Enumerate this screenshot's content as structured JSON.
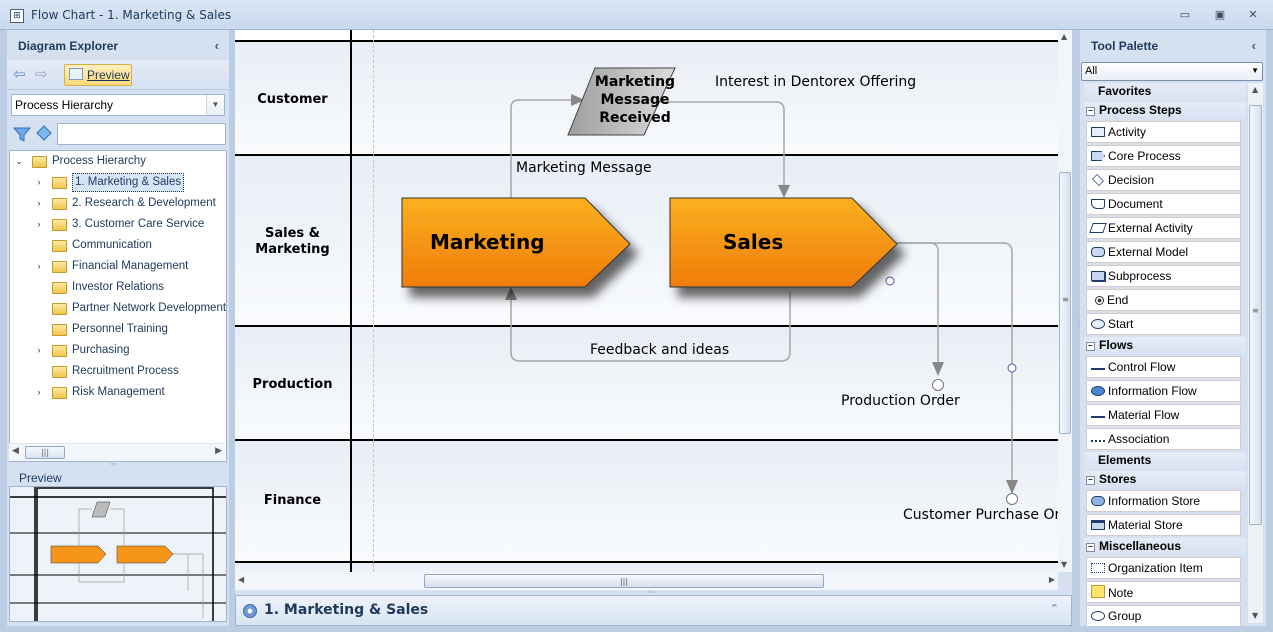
{
  "window": {
    "title": "Flow Chart - 1. Marketing & Sales",
    "app_icon": "org-chart-icon",
    "controls": {
      "minimize": "▭",
      "restore": "▣",
      "close": "✕"
    }
  },
  "diagram_explorer": {
    "title": "Diagram Explorer",
    "collapse_glyph": "‹",
    "back_glyph": "⇦",
    "forward_glyph": "⇨",
    "preview_button": "Preview",
    "view_select": "Process Hierarchy",
    "filter_placeholder": "",
    "tree": {
      "root": "Process Hierarchy",
      "items": [
        {
          "label": "1. Marketing & Sales",
          "expandable": true,
          "selected": true
        },
        {
          "label": "2. Research & Development",
          "expandable": true
        },
        {
          "label": "3. Customer Care Service",
          "expandable": true
        },
        {
          "label": "Communication",
          "expandable": false
        },
        {
          "label": "Financial Management",
          "expandable": true
        },
        {
          "label": "Investor Relations",
          "expandable": false
        },
        {
          "label": "Partner Network Development",
          "expandable": false
        },
        {
          "label": "Personnel Training",
          "expandable": false
        },
        {
          "label": "Purchasing",
          "expandable": true
        },
        {
          "label": "Recruitment Process",
          "expandable": false
        },
        {
          "label": "Risk Management",
          "expandable": true
        }
      ]
    },
    "preview_title": "Preview"
  },
  "diagram": {
    "lanes": [
      "Customer",
      "Sales & Marketing",
      "Production",
      "Finance"
    ],
    "shapes": {
      "message_received": "Marketing Message Received",
      "marketing": "Marketing",
      "sales": "Sales"
    },
    "labels": {
      "interest": "Interest in Dentorex Offering",
      "marketing_message": "Marketing Message",
      "feedback": "Feedback and ideas",
      "production_order": "Production Order",
      "customer_purchase_order": "Customer Purchase Ord"
    },
    "colors": {
      "process_top": "#fbb020",
      "process_bottom": "#f07c0a",
      "document_fill": "#b8b8b8",
      "connector": "#999999"
    }
  },
  "bottom_tab": {
    "title": "1. Marketing & Sales",
    "chevron": "⌃"
  },
  "tool_palette": {
    "title": "Tool Palette",
    "collapse_glyph": "‹",
    "filter": "All",
    "groups": [
      {
        "name": "Favorites",
        "toggle": false,
        "items": []
      },
      {
        "name": "Process Steps",
        "toggle": true,
        "items": [
          "Activity",
          "Core Process",
          "Decision",
          "Document",
          "External Activity",
          "External Model",
          "Subprocess",
          "End",
          "Start"
        ]
      },
      {
        "name": "Flows",
        "toggle": true,
        "items": [
          "Control Flow",
          "Information Flow",
          "Material Flow",
          "Association"
        ]
      },
      {
        "name": "Elements",
        "toggle": false,
        "items": []
      },
      {
        "name": "Stores",
        "toggle": true,
        "items": [
          "Information Store",
          "Material Store"
        ]
      },
      {
        "name": "Miscellaneous",
        "toggle": true,
        "items": [
          "Organization Item",
          "Note",
          "Group"
        ]
      }
    ]
  }
}
